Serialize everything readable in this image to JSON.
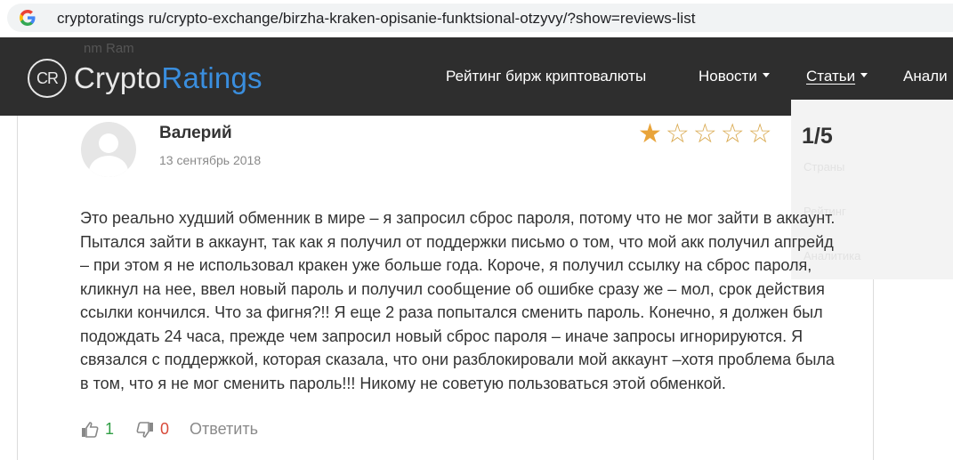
{
  "browser": {
    "url": "cryptoratings ru/crypto-exchange/birzha-kraken-opisanie-funktsional-otzyvy/?show=reviews-list"
  },
  "header": {
    "logo_mark": "CR",
    "logo_word_plain": "Crypto",
    "logo_word_accent": "Ratings",
    "accent_color": "#3a8ede",
    "ghost_text": "nm Ram",
    "nav": [
      {
        "label": "Рейтинг бирж криптовалюты",
        "has_dropdown": false
      },
      {
        "label": "Новости",
        "has_dropdown": true
      },
      {
        "label": "Статьи",
        "has_dropdown": true
      },
      {
        "label": "Анали",
        "has_dropdown": false
      }
    ]
  },
  "dropdown_ghost": {
    "items": [
      "...",
      "Страны",
      "Рейтинг",
      "Аналитика"
    ]
  },
  "review": {
    "author": "Валерий",
    "date": "13 сентябрь 2018",
    "rating_value": 1,
    "rating_max": 5,
    "rating_text": "1/5",
    "body": "Это реально худший обменник в мире – я запросил сброс пароля, потому что не мог зайти в аккаунт. Пытался зайти в аккаунт, так как я получил от поддержки письмо о том, что мой акк получил апгрейд – при этом я не использовал кракен уже больше года. Короче, я получил ссылку на сброс пароля, кликнул на нее, ввел новый пароль и получил сообщение об ошибке сразу же – мол, срок действия ссылки кончился. Что за фигня?!! Я еще 2 раза попытался сменить пароль. Конечно, я должен был подождать 24 часа, прежде чем запросил новый сброс пароля – иначе запросы игнорируются. Я связался с поддержкой, которая сказала, что они разблокировали мой аккаунт –хотя проблема была в том, что я не мог сменить пароль!!! Никому не советую пользоваться этой обменкой.",
    "likes": "1",
    "dislikes": "0",
    "reply_label": "Ответить",
    "like_color": "#2f9e44",
    "dislike_color": "#d84a3a",
    "star_color": "#e9a43a"
  }
}
